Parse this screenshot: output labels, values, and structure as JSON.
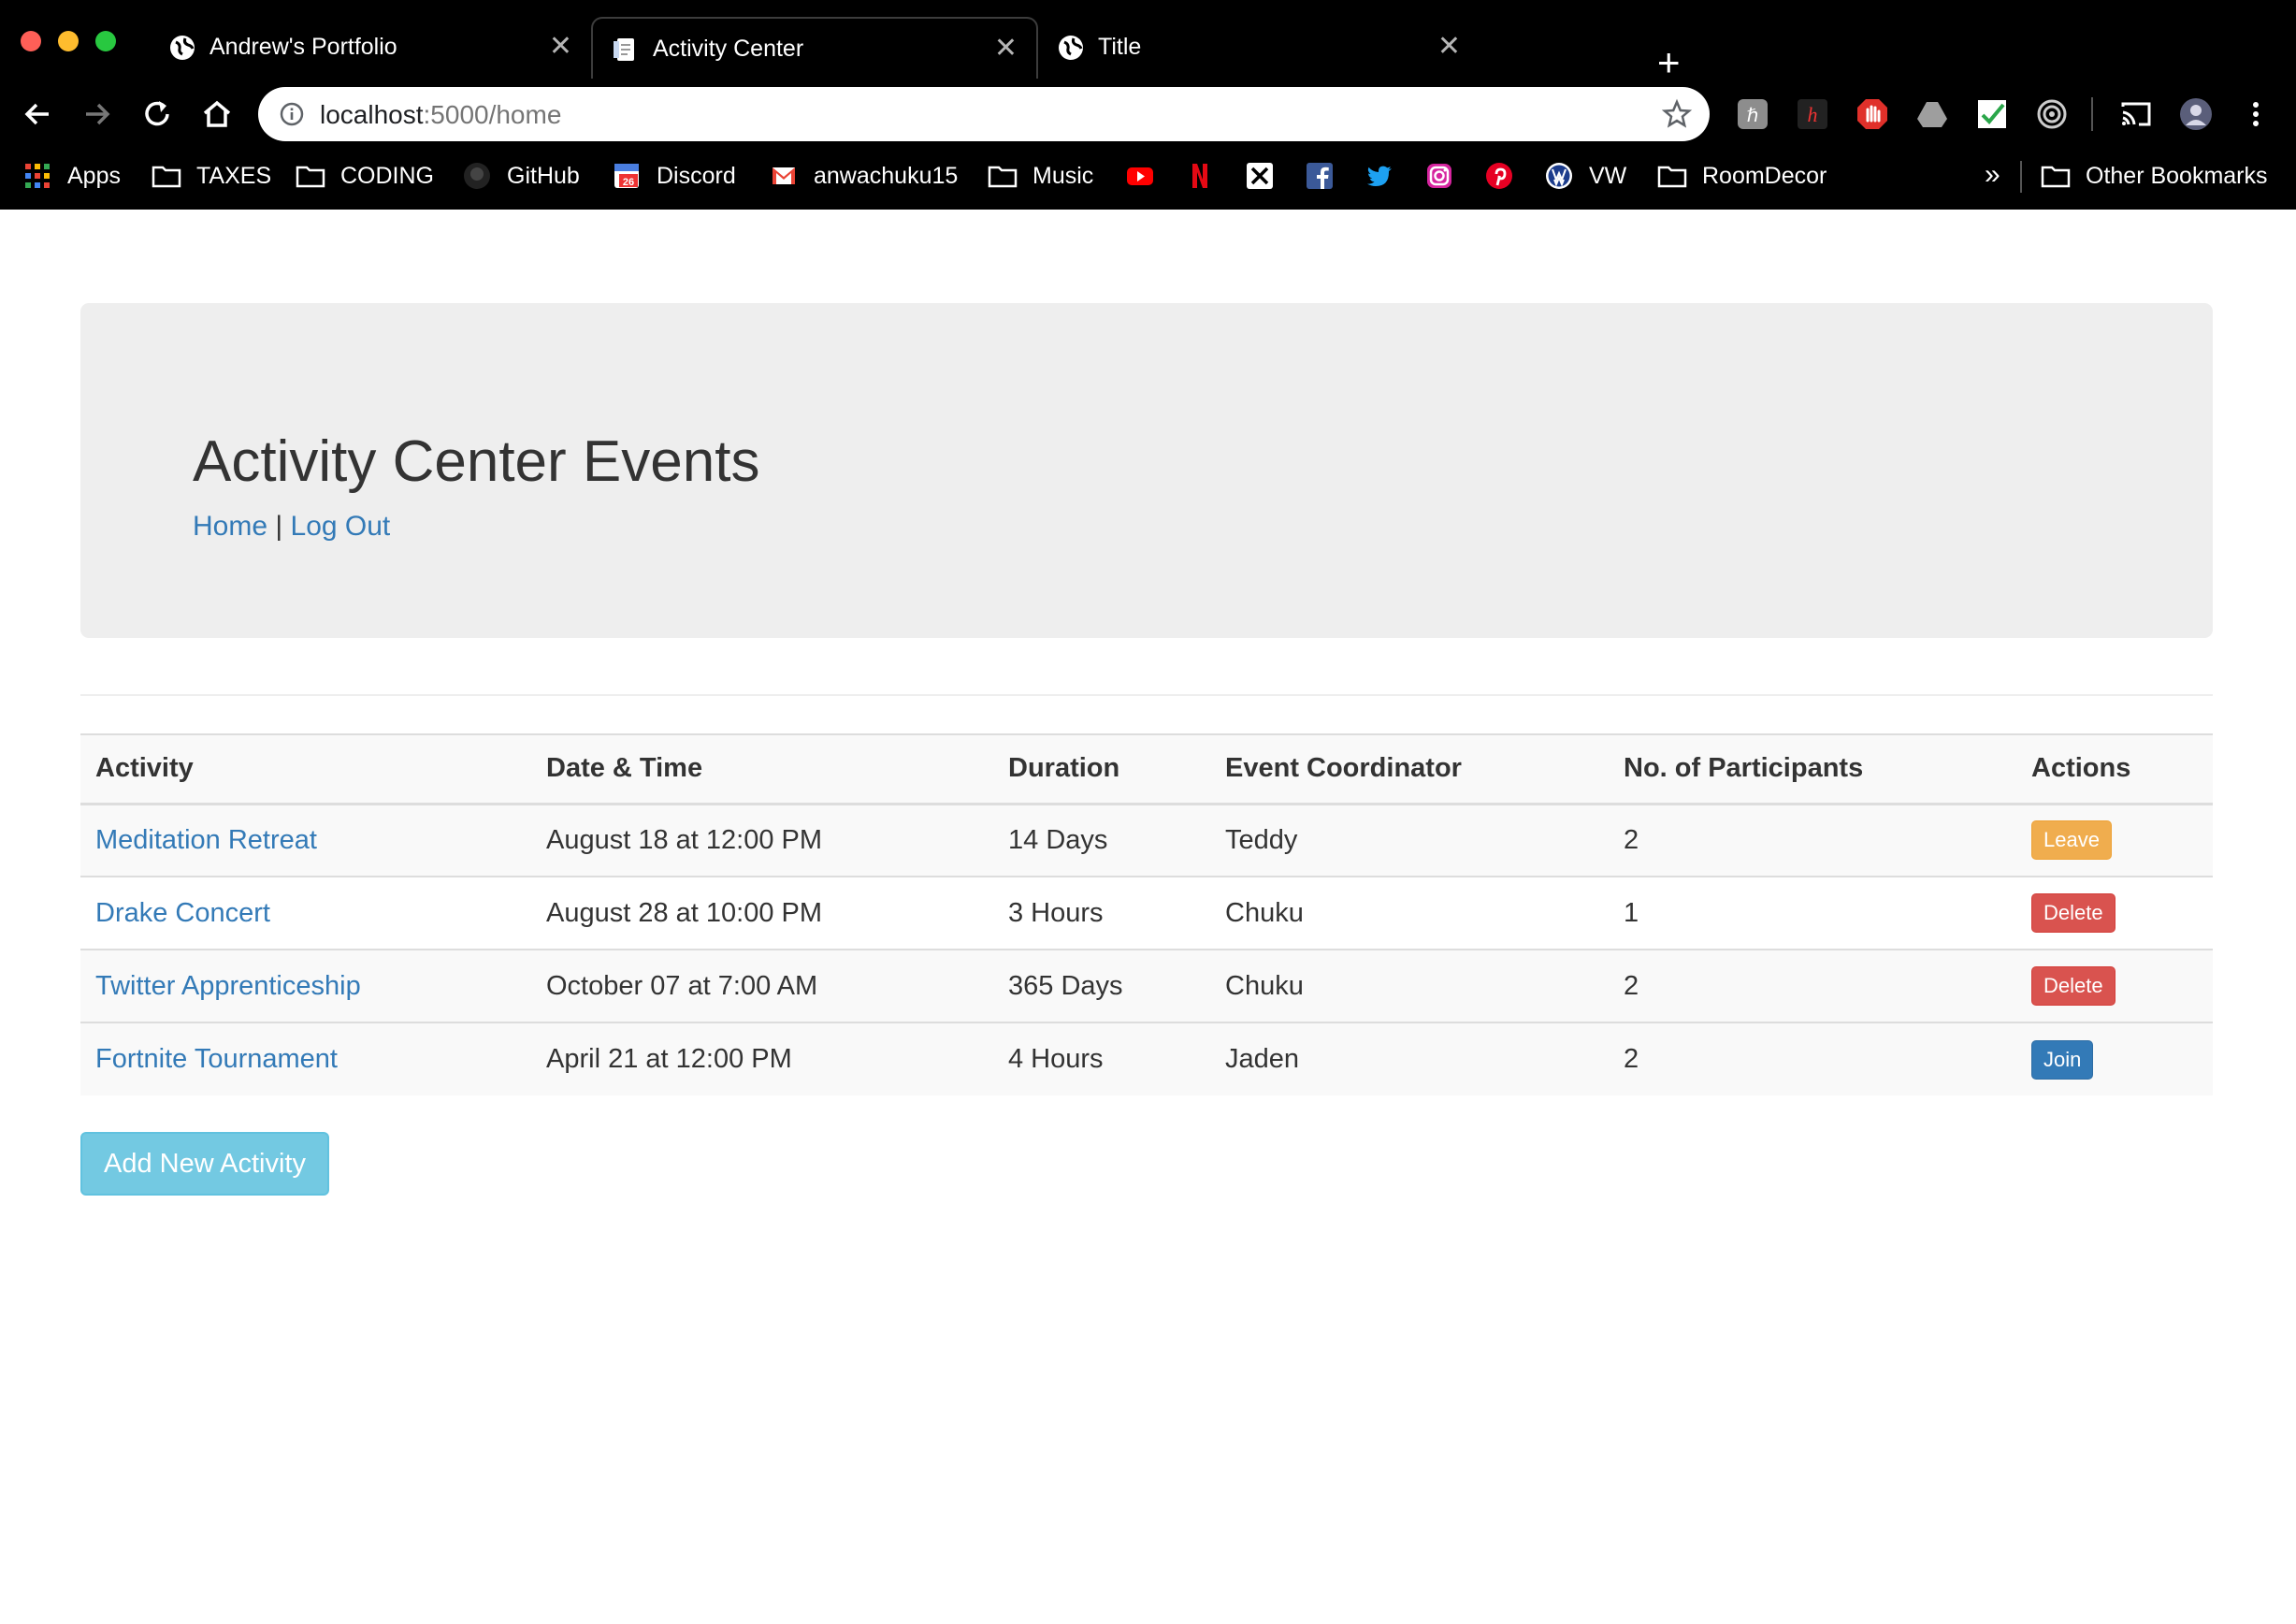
{
  "browser": {
    "tabs": [
      {
        "title": "Andrew's Portfolio",
        "icon": "globe-icon",
        "active": false
      },
      {
        "title": "Activity Center",
        "icon": "document-icon",
        "active": true
      },
      {
        "title": "Title",
        "icon": "globe-icon",
        "active": false
      }
    ],
    "close_glyph": "✕",
    "new_tab_glyph": "+",
    "url_host": "localhost",
    "url_path": ":5000/home",
    "bookmarks": [
      {
        "label": "Apps",
        "icon": "apps-grid-icon"
      },
      {
        "label": "TAXES",
        "icon": "folder-icon"
      },
      {
        "label": "CODING",
        "icon": "folder-icon"
      },
      {
        "label": "GitHub",
        "icon": "github-icon"
      },
      {
        "label": "Discord",
        "icon": "calendar-icon"
      },
      {
        "label": "anwachuku15",
        "icon": "gmail-icon"
      },
      {
        "label": "Music",
        "icon": "folder-icon"
      },
      {
        "label": "",
        "icon": "youtube-icon"
      },
      {
        "label": "",
        "icon": "netflix-icon"
      },
      {
        "label": "",
        "icon": "x-icon"
      },
      {
        "label": "",
        "icon": "facebook-icon"
      },
      {
        "label": "",
        "icon": "twitter-icon"
      },
      {
        "label": "",
        "icon": "instagram-icon"
      },
      {
        "label": "",
        "icon": "pinterest-icon"
      },
      {
        "label": "VW",
        "icon": "vw-icon"
      },
      {
        "label": "RoomDecor",
        "icon": "folder-icon"
      }
    ],
    "more_bookmarks_glyph": "»",
    "other_bookmarks": "Other Bookmarks"
  },
  "page": {
    "title": "Activity Center Events",
    "nav": {
      "home": "Home",
      "separator": "|",
      "logout": "Log Out"
    },
    "table": {
      "headers": [
        "Activity",
        "Date & Time",
        "Duration",
        "Event Coordinator",
        "No. of Participants",
        "Actions"
      ],
      "rows": [
        {
          "activity": "Meditation Retreat",
          "datetime": "August 18 at 12:00 PM",
          "duration": "14 Days",
          "coordinator": "Teddy",
          "participants": "2",
          "action": "Leave"
        },
        {
          "activity": "Drake Concert",
          "datetime": "August 28 at 10:00 PM",
          "duration": "3 Hours",
          "coordinator": "Chuku",
          "participants": "1",
          "action": "Delete"
        },
        {
          "activity": "Twitter Apprenticeship",
          "datetime": "October 07 at 7:00 AM",
          "duration": "365 Days",
          "coordinator": "Chuku",
          "participants": "2",
          "action": "Delete"
        },
        {
          "activity": "Fortnite Tournament",
          "datetime": "April 21 at 12:00 PM",
          "duration": "4 Hours",
          "coordinator": "Jaden",
          "participants": "2",
          "action": "Join"
        }
      ]
    },
    "add_button": "Add New Activity"
  },
  "colors": {
    "link": "#337ab7",
    "leave": "#f0ad4e",
    "delete": "#d9534f",
    "join": "#337ab7",
    "add": "#5bc0de",
    "jumbotron": "#eeeeee"
  }
}
